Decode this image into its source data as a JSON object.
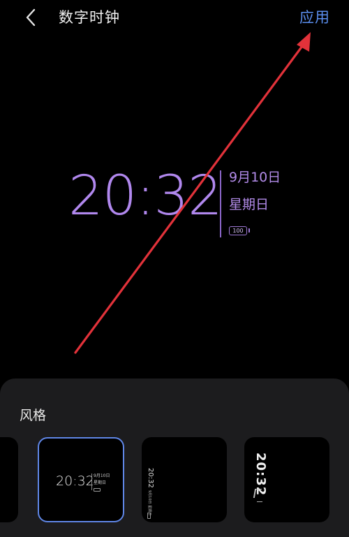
{
  "header": {
    "back_icon": "chevron-left-icon",
    "title": "数字时钟",
    "apply_label": "应用"
  },
  "clock": {
    "time": "20:32",
    "date": "9月10日",
    "weekday": "星期日",
    "battery": "100"
  },
  "style_panel": {
    "label": "风格",
    "thumbnails": [
      {
        "time": "20:32",
        "date": "9月10日",
        "weekday": "星期日"
      },
      {
        "time": "20:32",
        "date": "9月10日 星期日"
      },
      {
        "time": "20:32"
      }
    ]
  },
  "colors": {
    "accent": "#5b8ff0",
    "clock": "#b188ee",
    "annotation_arrow": "#e2323a",
    "panel": "#1c1c1e"
  }
}
